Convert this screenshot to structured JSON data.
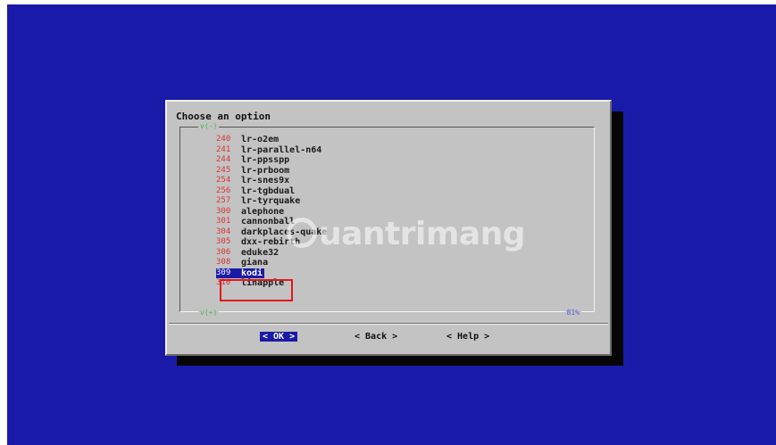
{
  "dialog": {
    "title": "Choose an option",
    "scroll_top": "v(-)",
    "scroll_bottom": "v(+)",
    "scroll_percent": "81%",
    "items": [
      {
        "num": "240",
        "tag": "lr-o2em"
      },
      {
        "num": "241",
        "tag": "lr-parallel-n64"
      },
      {
        "num": "244",
        "tag": "lr-ppsspp"
      },
      {
        "num": "245",
        "tag": "lr-prboom"
      },
      {
        "num": "254",
        "tag": "lr-snes9x"
      },
      {
        "num": "256",
        "tag": "lr-tgbdual"
      },
      {
        "num": "257",
        "tag": "lr-tyrquake"
      },
      {
        "num": "300",
        "tag": "alephone"
      },
      {
        "num": "301",
        "tag": "cannonball"
      },
      {
        "num": "304",
        "tag": "darkplaces-quake"
      },
      {
        "num": "305",
        "tag": "dxx-rebirth"
      },
      {
        "num": "306",
        "tag": "eduke32"
      },
      {
        "num": "308",
        "tag": "giana"
      },
      {
        "num": "309",
        "tag": "kodi"
      },
      {
        "num": "310",
        "tag": "linapple"
      }
    ],
    "selected_index": 13,
    "buttons": {
      "ok": "< OK >",
      "back": "< Back >",
      "help": "< Help >"
    }
  },
  "watermark": "uantrimang",
  "colors": {
    "background": "#1a1aa8",
    "dialog": "#c3c3c3",
    "highlight_box": "#e0191b",
    "number": "#dd3333"
  }
}
